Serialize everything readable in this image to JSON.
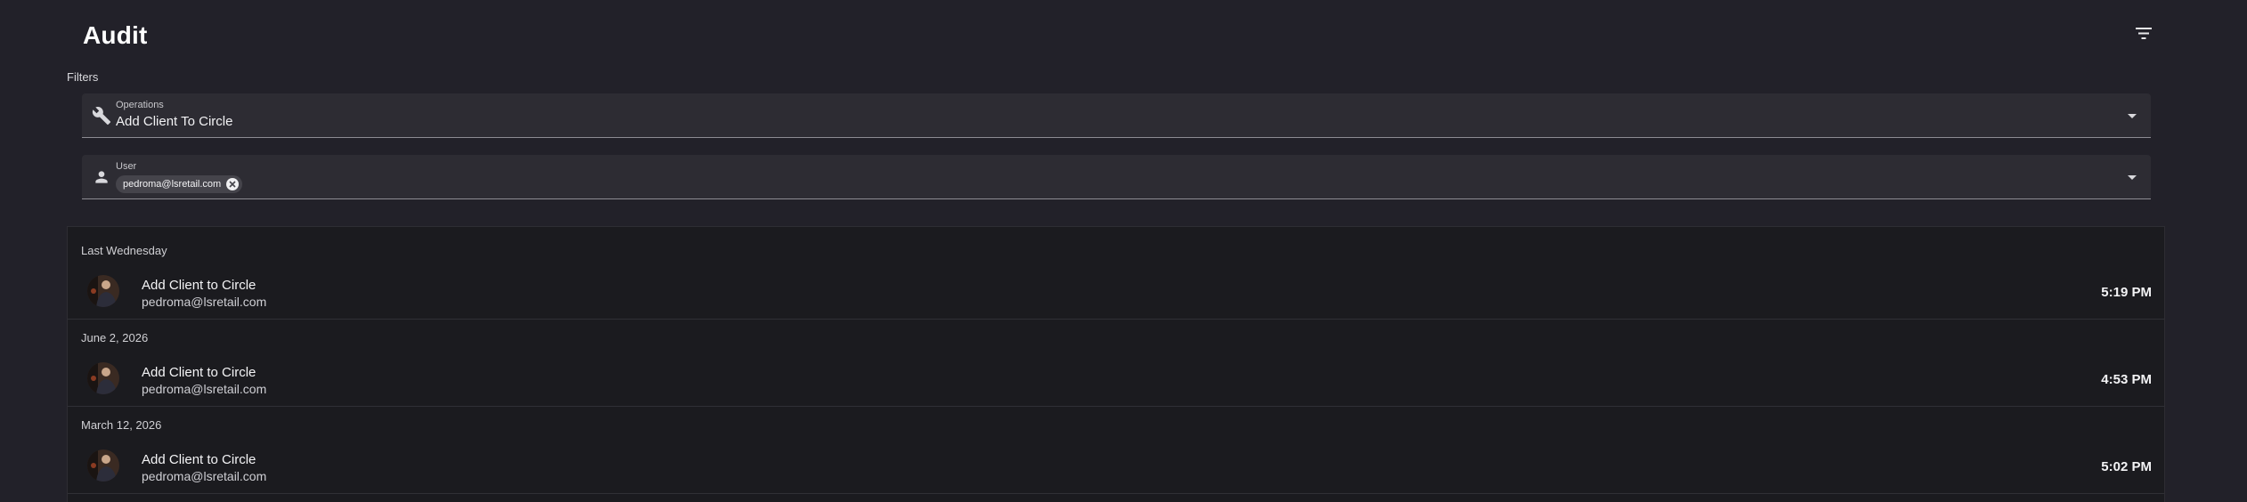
{
  "page": {
    "title": "Audit"
  },
  "toolbar": {
    "filter_icon": "filter-list-icon"
  },
  "filters": {
    "label": "Filters",
    "operations": {
      "label": "Operations",
      "value": "Add Client To Circle",
      "icon": "wrench-icon"
    },
    "user": {
      "label": "User",
      "icon": "person-icon",
      "chips": [
        "pedroma@lsretail.com"
      ]
    }
  },
  "audit_groups": [
    {
      "date": "Last Wednesday",
      "entries": [
        {
          "title": "Add Client to Circle",
          "user": "pedroma@lsretail.com",
          "time": "5:19 PM"
        }
      ]
    },
    {
      "date": "June 2, 2026",
      "entries": [
        {
          "title": "Add Client to Circle",
          "user": "pedroma@lsretail.com",
          "time": "4:53 PM"
        }
      ]
    },
    {
      "date": "March 12, 2026",
      "entries": [
        {
          "title": "Add Client to Circle",
          "user": "pedroma@lsretail.com",
          "time": "5:02 PM"
        }
      ]
    }
  ],
  "colors": {
    "background": "#222129",
    "list_background": "#1b1b1f",
    "field_background": "#2d2c33",
    "chip_background": "#45444b"
  }
}
